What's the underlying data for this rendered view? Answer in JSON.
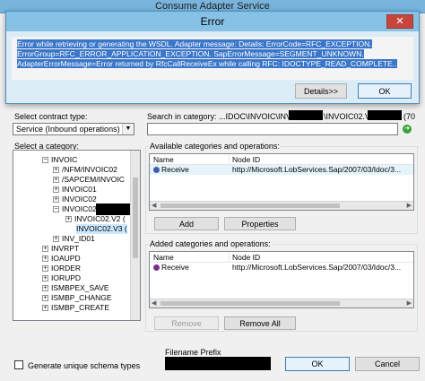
{
  "window": {
    "title": "Consume Adapter Service"
  },
  "error_dialog": {
    "title": "Error",
    "close_label": "✕",
    "message": "Error while retrieving or generating the WSDL. Adapter message: Details: ErrorCode=RFC_EXCEPTION. ErrorGroup=RFC_ERROR_APPLICATION_EXCEPTION. SapErrorMessage=SEGMENT_UNKNOWN.  AdapterErrorMessage=Error returned by RfcCallReceiveEx while calling RFC: IDOCTYPE_READ_COMPLETE..",
    "details_label": "Details>>",
    "ok_label": "OK"
  },
  "contract": {
    "label": "Select contract type:",
    "value": "Service (Inbound operations)"
  },
  "search": {
    "label_prefix": "Search in category: ...IDOC\\INVOIC\\INVOIC02",
    "label_mid": "\\INVOIC02.V3",
    "label_suffix": "(70",
    "value": ""
  },
  "category": {
    "label": "Select a category:",
    "items": [
      {
        "label": "INVOIC",
        "exp": "−"
      },
      {
        "label": "/NFM/INVOIC02",
        "exp": "+"
      },
      {
        "label": "/SAPCEM/INVOIC",
        "exp": "+"
      },
      {
        "label": "INVOIC01",
        "exp": "+"
      },
      {
        "label": "INVOIC02",
        "exp": "+"
      },
      {
        "label": "INVOIC02",
        "exp": "−"
      },
      {
        "label": "INVOIC02.V2 (",
        "exp": "+"
      },
      {
        "label": "INVOIC02.V3 (",
        "exp": ""
      },
      {
        "label": "INV_ID01",
        "exp": "+"
      },
      {
        "label": "INVRPT",
        "exp": "+"
      },
      {
        "label": "IOAUPD",
        "exp": "+"
      },
      {
        "label": "IORDER",
        "exp": "+"
      },
      {
        "label": "IORUPD",
        "exp": "+"
      },
      {
        "label": "ISMBPEX_SAVE",
        "exp": "+"
      },
      {
        "label": "ISMBP_CHANGE",
        "exp": "+"
      },
      {
        "label": "ISMBP_CREATE",
        "exp": "+"
      }
    ]
  },
  "available": {
    "label": "Available categories and operations:",
    "col_name": "Name",
    "col_node": "Node ID",
    "rows": [
      {
        "name": "Receive",
        "node": "http://Microsoft.LobServices.Sap/2007/03/Idoc/3..."
      }
    ],
    "add_label": "Add",
    "properties_label": "Properties"
  },
  "added": {
    "label": "Added categories and operations:",
    "col_name": "Name",
    "col_node": "Node ID",
    "rows": [
      {
        "name": "Receive",
        "node": "http://Microsoft.LobServices.Sap/2007/03/Idoc/3..."
      }
    ],
    "remove_label": "Remove",
    "remove_all_label": "Remove All"
  },
  "footer": {
    "unique_label": "Generate unique schema types",
    "filename_label": "Filename Prefix",
    "ok_label": "OK",
    "cancel_label": "Cancel"
  },
  "colors": {
    "accent": "#3a76c9",
    "title_bar": "#87c1e6",
    "close": "#c7453a"
  }
}
